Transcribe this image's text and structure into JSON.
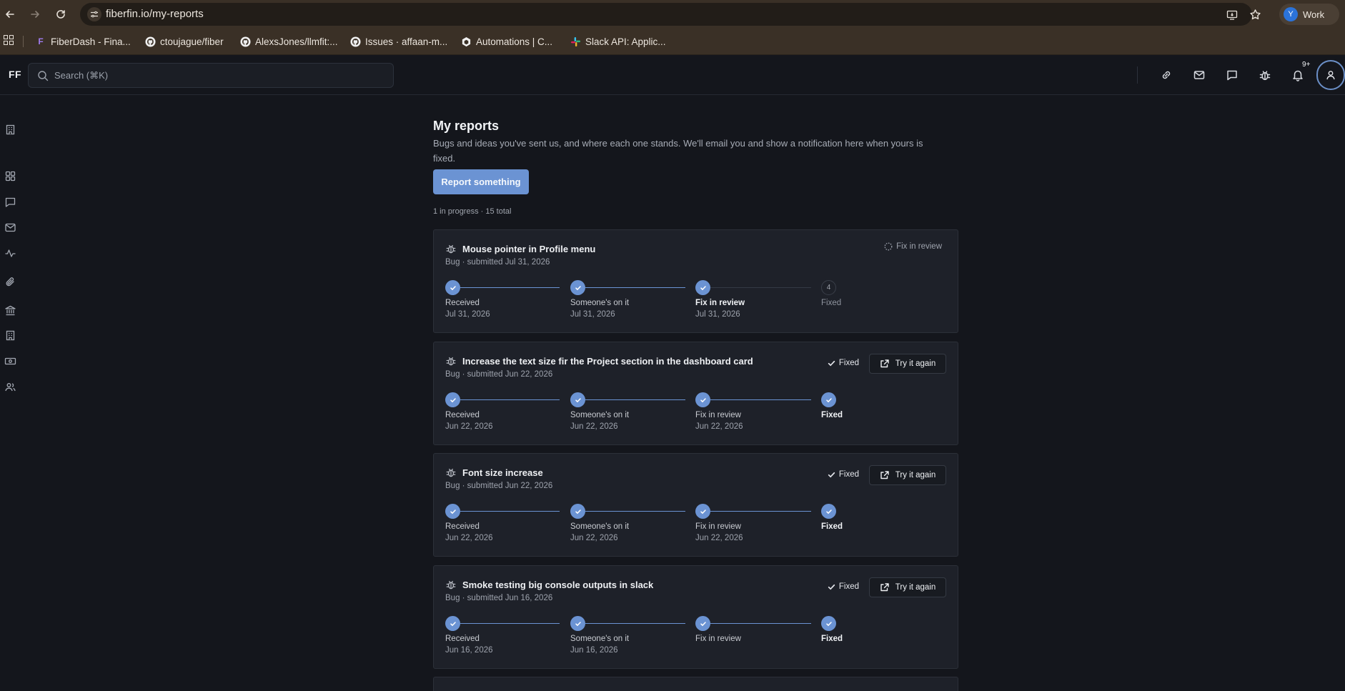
{
  "browser": {
    "url": "fiberfin.io/my-reports",
    "profile_initial": "Y",
    "profile_name": "Work",
    "bookmarks": [
      {
        "label": "FiberDash - Fina...",
        "icon": "fiberdash-favicon"
      },
      {
        "label": "ctoujague/fiber",
        "icon": "github-icon"
      },
      {
        "label": "AlexsJones/llmfit:...",
        "icon": "github-icon"
      },
      {
        "label": "Issues · affaan-m...",
        "icon": "github-icon"
      },
      {
        "label": "Automations | C...",
        "icon": "automations-favicon"
      },
      {
        "label": "Slack API: Applic...",
        "icon": "slack-icon"
      }
    ]
  },
  "header": {
    "logo": "FF",
    "search_placeholder": "Search (⌘K)",
    "notification_count": "9+",
    "icons": [
      "link-icon",
      "mail-icon",
      "message-icon",
      "bug-icon",
      "bell-icon",
      "user-icon"
    ]
  },
  "sidebar": {
    "icons": [
      "building-icon",
      "grid-icon",
      "message-icon",
      "mail-icon",
      "activity-icon",
      "paperclip-icon",
      "bank-icon",
      "building-icon",
      "money-icon",
      "users-icon"
    ]
  },
  "page": {
    "title": "My reports",
    "subtitle": "Bugs and ideas you've sent us, and where each one stands. We'll email you and show a notification here when yours is fixed.",
    "report_button": "Report something",
    "summary": "1 in progress · 15 total"
  },
  "colors": {
    "accent": "#6b93d3",
    "background": "#14161c",
    "card": "#1e2129"
  },
  "reports": [
    {
      "title": "Mouse pointer in Profile menu",
      "meta": "Bug · submitted Jul 31, 2026",
      "status": "Fix in review",
      "steps": [
        {
          "label": "Received",
          "date": "Jul 31, 2026"
        },
        {
          "label": "Someone's on it",
          "date": "Jul 31, 2026"
        },
        {
          "label": "Fix in review",
          "date": "Jul 31, 2026"
        },
        {
          "label": "Fixed",
          "date": "",
          "number": "4"
        }
      ]
    },
    {
      "title": "Increase the text size fir the Project section in the dashboard card",
      "meta": "Bug · submitted Jun 22, 2026",
      "status": "Fixed",
      "action": "Try it again",
      "steps": [
        {
          "label": "Received",
          "date": "Jun 22, 2026"
        },
        {
          "label": "Someone's on it",
          "date": "Jun 22, 2026"
        },
        {
          "label": "Fix in review",
          "date": "Jun 22, 2026"
        },
        {
          "label": "Fixed",
          "date": ""
        }
      ]
    },
    {
      "title": "Font size increase",
      "meta": "Bug · submitted Jun 22, 2026",
      "status": "Fixed",
      "action": "Try it again",
      "steps": [
        {
          "label": "Received",
          "date": "Jun 22, 2026"
        },
        {
          "label": "Someone's on it",
          "date": "Jun 22, 2026"
        },
        {
          "label": "Fix in review",
          "date": "Jun 22, 2026"
        },
        {
          "label": "Fixed",
          "date": ""
        }
      ]
    },
    {
      "title": "Smoke testing big console outputs in slack",
      "meta": "Bug · submitted Jun 16, 2026",
      "status": "Fixed",
      "action": "Try it again",
      "steps": [
        {
          "label": "Received",
          "date": "Jun 16, 2026"
        },
        {
          "label": "Someone's on it",
          "date": "Jun 16, 2026"
        },
        {
          "label": "Fix in review",
          "date": ""
        },
        {
          "label": "Fixed",
          "date": ""
        }
      ]
    }
  ]
}
